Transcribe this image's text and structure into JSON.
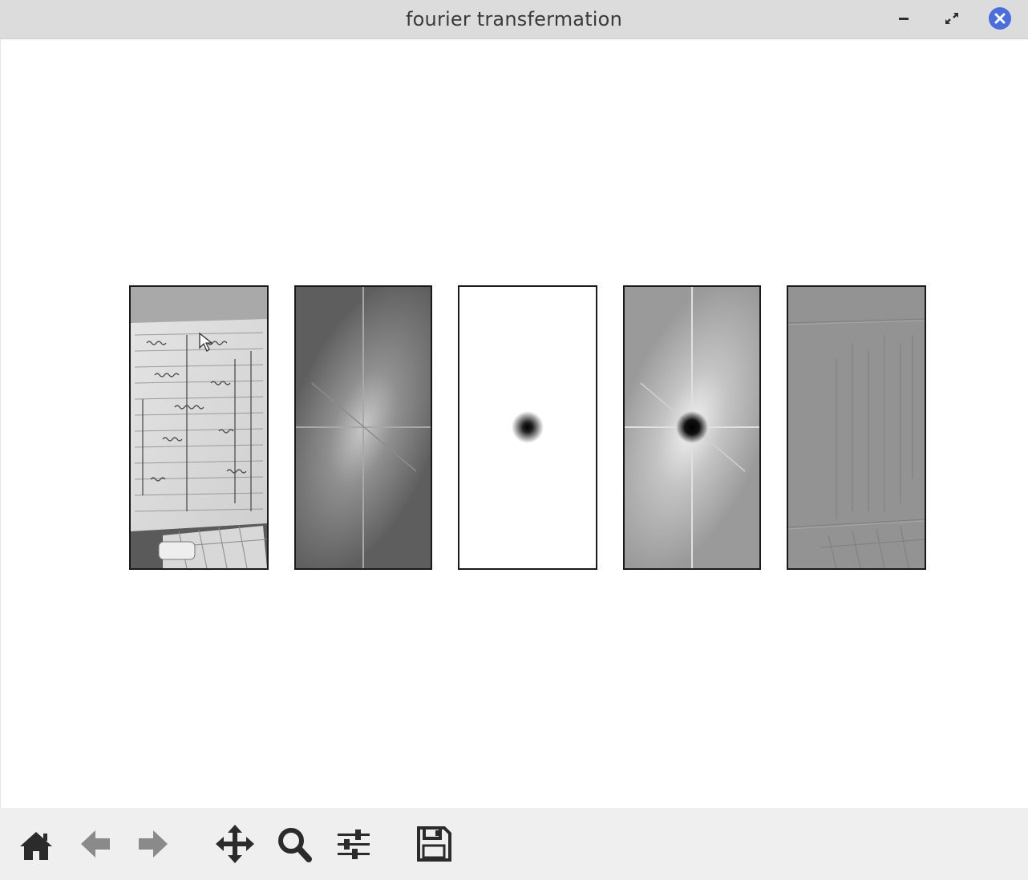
{
  "window": {
    "title": "fourier transfermation",
    "controls": [
      "minimize-icon",
      "restore-icon",
      "close-icon"
    ],
    "close_color": "#4a6ee0"
  },
  "figure": {
    "panels": [
      {
        "name": "original-image-panel",
        "content": "grayscale photo of handwritten math notes"
      },
      {
        "name": "magnitude-spectrum-panel",
        "content": "log magnitude spectrum"
      },
      {
        "name": "highpass-mask-panel",
        "content": "gaussian high-pass mask"
      },
      {
        "name": "filtered-spectrum-panel",
        "content": "masked spectrum"
      },
      {
        "name": "filtered-image-panel",
        "content": "inverse transform result"
      }
    ]
  },
  "toolbar": {
    "buttons": [
      "home-icon",
      "back-arrow-icon",
      "forward-arrow-icon",
      "pan-icon",
      "zoom-icon",
      "configure-subplots-icon",
      "save-icon"
    ]
  }
}
